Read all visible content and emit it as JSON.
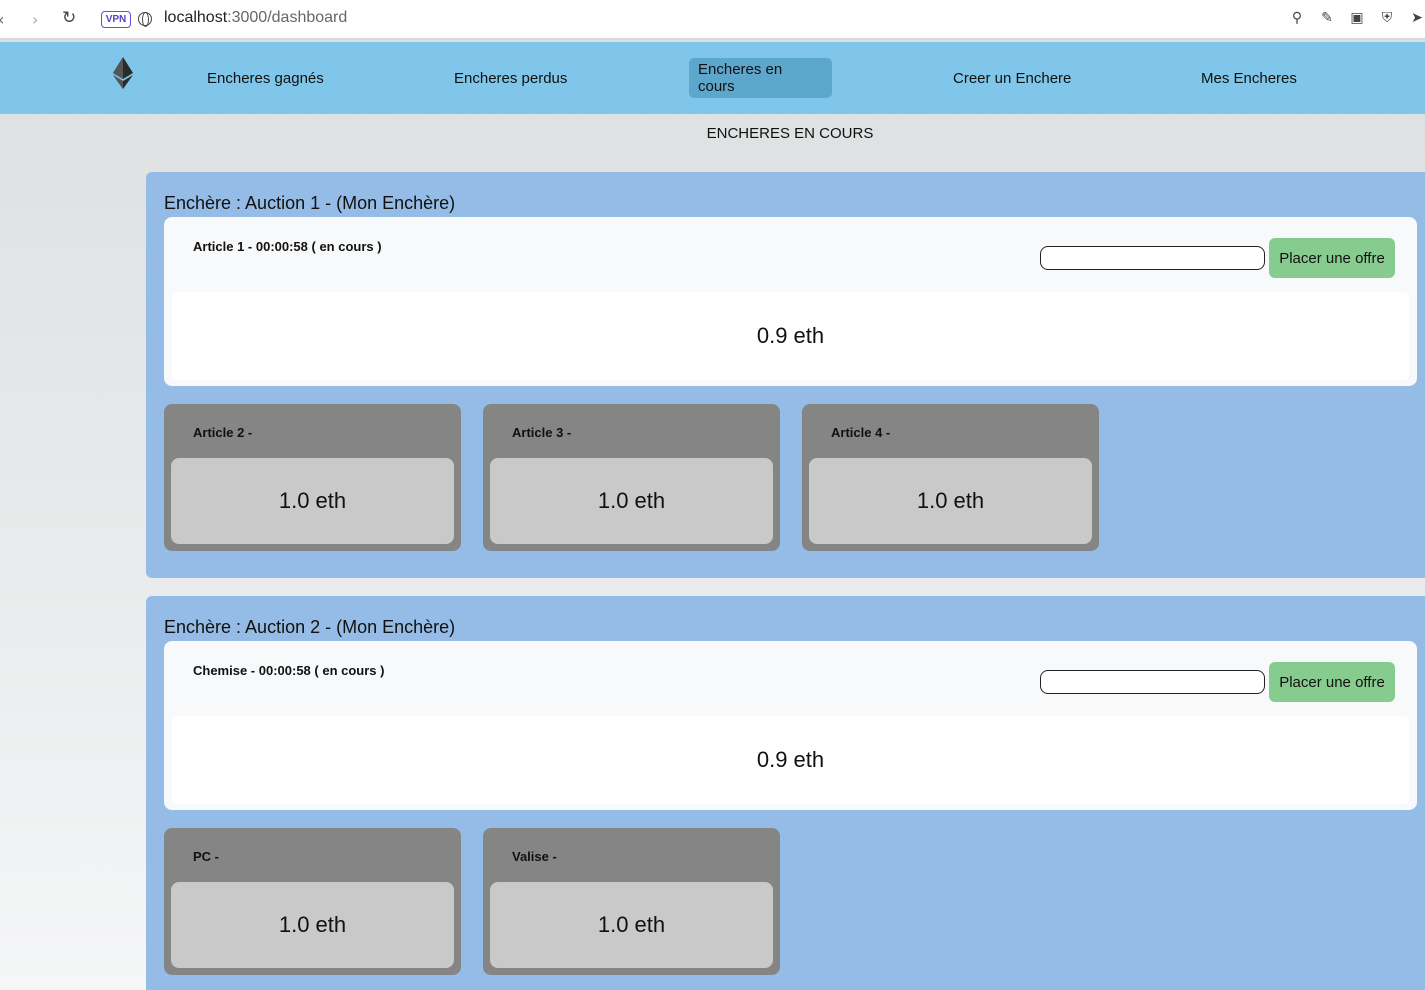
{
  "browser": {
    "vpn_label": "VPN",
    "url_host": "localhost",
    "url_path": ":3000/dashboard"
  },
  "nav": {
    "items": [
      {
        "label": "Encheres gagnés"
      },
      {
        "label": "Encheres perdus"
      },
      {
        "label": "Encheres en cours",
        "active": true
      },
      {
        "label": "Creer un Enchere"
      },
      {
        "label": "Mes Encheres"
      }
    ]
  },
  "page": {
    "heading": "ENCHERES EN COURS"
  },
  "auctions": [
    {
      "title": "Enchère : Auction 1 - (Mon Enchère)",
      "current": {
        "label": "Article 1 - 00:00:58 ( en cours )",
        "price": "0.9 eth",
        "input_value": "",
        "button_label": "Placer une offre"
      },
      "others": [
        {
          "label": "Article 2 -",
          "price": "1.0 eth"
        },
        {
          "label": "Article 3 -",
          "price": "1.0 eth"
        },
        {
          "label": "Article 4 -",
          "price": "1.0 eth"
        }
      ]
    },
    {
      "title": "Enchère : Auction 2 - (Mon Enchère)",
      "current": {
        "label": "Chemise - 00:00:58 ( en cours )",
        "price": "0.9 eth",
        "input_value": "",
        "button_label": "Placer une offre"
      },
      "others": [
        {
          "label": "PC -",
          "price": "1.0 eth"
        },
        {
          "label": "Valise -",
          "price": "1.0 eth"
        }
      ]
    }
  ],
  "colors": {
    "nav_bg": "#7fc6ea",
    "nav_active": "#5ea7cc",
    "auction_bg": "#95bce6",
    "bid_button": "#86cc8e",
    "item_card": "#858585",
    "item_price_box": "#c9c9c9"
  }
}
